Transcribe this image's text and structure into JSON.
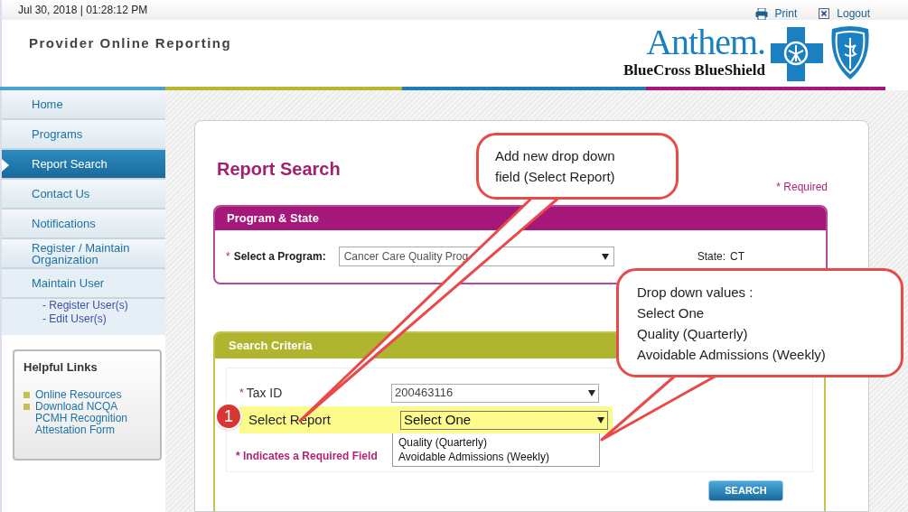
{
  "top_bar": {
    "datetime": "Jul 30, 2018 | 01:28:12 PM",
    "links": [
      {
        "kind": "print",
        "label": "Print"
      },
      {
        "kind": "logout",
        "label": "Logout"
      }
    ]
  },
  "header": {
    "title": "Provider Online Reporting",
    "logo_name": "Anthem.",
    "logo_subtitle": "BlueCross BlueShield"
  },
  "sidebar": {
    "items": [
      {
        "label": "Home",
        "selected": false
      },
      {
        "label": "Programs",
        "selected": false
      },
      {
        "label": "Report Search",
        "selected": true
      },
      {
        "label": "Contact Us",
        "selected": false
      },
      {
        "label": "Notifications",
        "selected": false
      },
      {
        "label": "Register / Maintain Organization",
        "selected": false
      },
      {
        "label": "Maintain User",
        "selected": false,
        "children": [
          {
            "label": "- Register User(s)"
          },
          {
            "label": "- Edit User(s)"
          }
        ]
      }
    ]
  },
  "helpful_links": {
    "title": "Helpful Links",
    "links": [
      "Online Resources",
      "Download NCQA PCMH Recognition Attestation Form"
    ]
  },
  "page": {
    "title": "Report Search",
    "required_note": "* Required"
  },
  "program_panel": {
    "title": "Program & State",
    "required_mark": "*",
    "program_label": "Select a Program:",
    "program_value": "Cancer Care Quality Prog",
    "state_label": "State:",
    "state_value": "CT"
  },
  "criteria_panel": {
    "title": "Search Criteria",
    "fields": [
      {
        "label": "Tax ID",
        "required_mark": "*",
        "value": "200463116",
        "highlighted": false,
        "expanded": false
      },
      {
        "label": "Select Report",
        "value": "Select One",
        "highlighted": true,
        "expanded": true,
        "options": [
          "Quality (Quarterly)",
          "Avoidable Admissions (Weekly)"
        ]
      }
    ],
    "required_note": "* Indicates a Required Field",
    "search_button": "SEARCH"
  },
  "step_badge": "1",
  "callouts": [
    {
      "lines": [
        "Add new drop down",
        "field (Select Report)"
      ]
    },
    {
      "lines": [
        "Drop down values :",
        "Select One",
        "Quality (Quarterly)",
        "Avoidable Admissions (Weekly)"
      ]
    }
  ]
}
